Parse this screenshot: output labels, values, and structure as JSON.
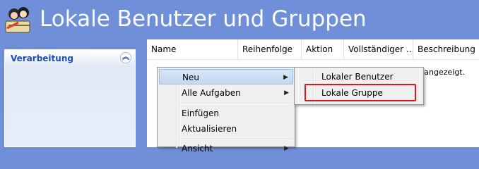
{
  "header": {
    "title": "Lokale Benutzer und Gruppen",
    "icon": "users-groups-icon"
  },
  "left_panel": {
    "title": "Verarbeitung",
    "collapse_icon": "double-chevron-up-icon"
  },
  "columns": [
    "Name",
    "Reihenfolge",
    "Aktion",
    "Vollständiger ...",
    "Beschreibung"
  ],
  "empty_message": "e angezeigt.",
  "context_menu": {
    "items": [
      {
        "label": "Neu",
        "has_submenu": true,
        "highlighted": true
      },
      {
        "label": "Alle Aufgaben",
        "has_submenu": true
      },
      {
        "label": "Einfügen"
      },
      {
        "label": "Aktualisieren"
      },
      {
        "label": "Ansicht",
        "has_submenu": true
      }
    ]
  },
  "submenu": {
    "items": [
      {
        "label": "Lokaler Benutzer"
      },
      {
        "label": "Lokale Gruppe",
        "highlighted_box": true
      }
    ]
  },
  "colors": {
    "header_bg": "#6f8fd8",
    "accent_text": "#1a4db3",
    "highlight_border": "#e0141e"
  }
}
